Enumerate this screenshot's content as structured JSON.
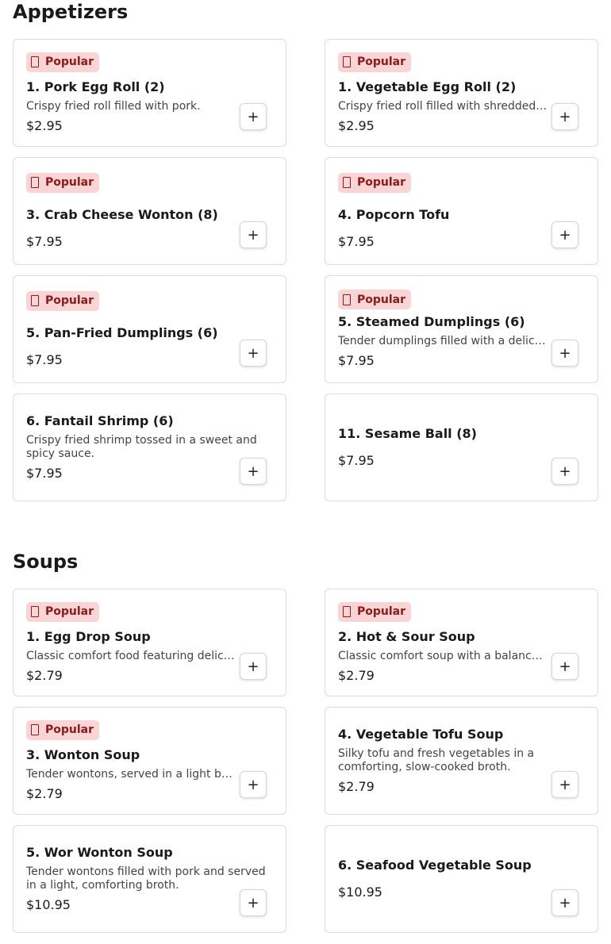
{
  "sections": [
    {
      "title": "Appetizers",
      "items": [
        {
          "popular": true,
          "badge": "Popular",
          "name": "1. Pork Egg Roll (2)",
          "desc": "Crispy fried roll filled with pork.",
          "price": "$2.95"
        },
        {
          "popular": true,
          "badge": "Popular",
          "name": "1. Vegetable Egg Roll (2)",
          "desc": "Crispy fried roll filled with shredded…",
          "price": "$2.95"
        },
        {
          "popular": true,
          "badge": "Popular",
          "name": "3. Crab Cheese Wonton (8)",
          "desc": "",
          "price": "$7.95"
        },
        {
          "popular": true,
          "badge": "Popular",
          "name": "4. Popcorn Tofu",
          "desc": "",
          "price": "$7.95"
        },
        {
          "popular": true,
          "badge": "Popular",
          "name": "5. Pan-Fried Dumplings (6)",
          "desc": "",
          "price": "$7.95"
        },
        {
          "popular": true,
          "badge": "Popular",
          "name": "5. Steamed Dumplings (6)",
          "desc": "Tender dumplings filled with a delicate",
          "price": "$7.95"
        },
        {
          "popular": false,
          "badge": "",
          "name": "6. Fantail Shrimp (6)",
          "desc": "Crispy fried shrimp tossed in a sweet and spicy sauce.",
          "price": "$7.95"
        },
        {
          "popular": false,
          "badge": "",
          "name": "11. Sesame Ball (8)",
          "desc": "",
          "price": "$7.95"
        }
      ]
    },
    {
      "title": "Soups",
      "items": [
        {
          "popular": true,
          "badge": "Popular",
          "name": "1. Egg Drop Soup",
          "desc": "Classic comfort food featuring delicate…",
          "price": "$2.79"
        },
        {
          "popular": true,
          "badge": "Popular",
          "name": "2. Hot & Sour Soup",
          "desc": "Classic comfort soup with a balance of…",
          "price": "$2.79"
        },
        {
          "popular": true,
          "badge": "Popular",
          "name": "3. Wonton Soup",
          "desc": "Tender wontons, served in a light broth…",
          "price": "$2.79"
        },
        {
          "popular": false,
          "badge": "",
          "name": "4. Vegetable Tofu Soup",
          "desc": "Silky tofu and fresh vegetables in a comforting, slow-cooked broth.",
          "price": "$2.79"
        },
        {
          "popular": false,
          "badge": "",
          "name": "5. Wor Wonton Soup",
          "desc": "Tender wontons filled with pork and served in a light, comforting broth.",
          "price": "$10.95"
        },
        {
          "popular": false,
          "badge": "",
          "name": "6. Seafood Vegetable Soup",
          "desc": "",
          "price": "$10.95"
        }
      ]
    }
  ],
  "add_button_label": "+",
  "colors": {
    "badge_bg": "#fbd5d5",
    "badge_text": "#8b1a1a",
    "card_border": "#dcdcdc"
  }
}
